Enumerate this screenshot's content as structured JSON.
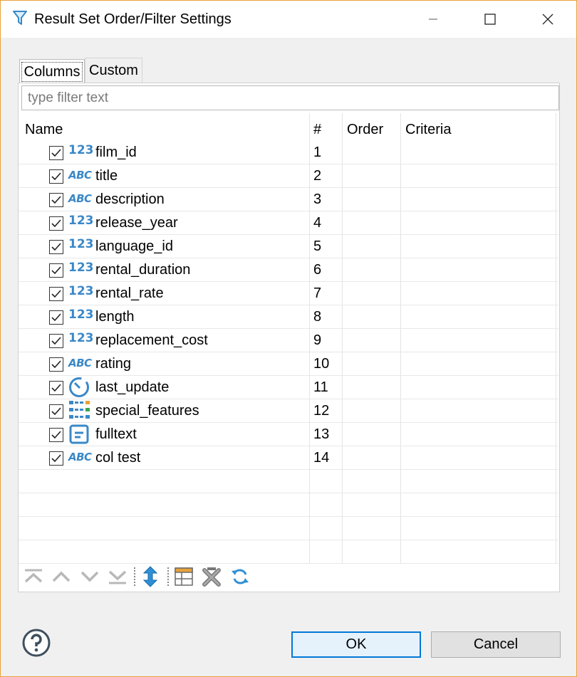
{
  "window": {
    "title": "Result Set Order/Filter Settings"
  },
  "tabs": [
    {
      "label": "Columns",
      "active": true
    },
    {
      "label": "Custom",
      "active": false
    }
  ],
  "filter": {
    "placeholder": "type filter text",
    "value": ""
  },
  "table": {
    "headers": {
      "name": "Name",
      "num": "#",
      "order": "Order",
      "criteria": "Criteria"
    },
    "rows": [
      {
        "checked": true,
        "type_icon": "numeric-123-icon",
        "name": "film_id",
        "num": "1",
        "order": "",
        "criteria": ""
      },
      {
        "checked": true,
        "type_icon": "string-abc-icon",
        "name": "title",
        "num": "2",
        "order": "",
        "criteria": ""
      },
      {
        "checked": true,
        "type_icon": "string-abc-icon",
        "name": "description",
        "num": "3",
        "order": "",
        "criteria": ""
      },
      {
        "checked": true,
        "type_icon": "numeric-123-icon",
        "name": "release_year",
        "num": "4",
        "order": "",
        "criteria": ""
      },
      {
        "checked": true,
        "type_icon": "numeric-123-icon",
        "name": "language_id",
        "num": "5",
        "order": "",
        "criteria": ""
      },
      {
        "checked": true,
        "type_icon": "numeric-123-icon",
        "name": "rental_duration",
        "num": "6",
        "order": "",
        "criteria": ""
      },
      {
        "checked": true,
        "type_icon": "numeric-123-icon",
        "name": "rental_rate",
        "num": "7",
        "order": "",
        "criteria": ""
      },
      {
        "checked": true,
        "type_icon": "numeric-123-icon",
        "name": "length",
        "num": "8",
        "order": "",
        "criteria": ""
      },
      {
        "checked": true,
        "type_icon": "numeric-123-icon",
        "name": "replacement_cost",
        "num": "9",
        "order": "",
        "criteria": ""
      },
      {
        "checked": true,
        "type_icon": "string-abc-icon",
        "name": "rating",
        "num": "10",
        "order": "",
        "criteria": ""
      },
      {
        "checked": true,
        "type_icon": "datetime-clock-icon",
        "name": "last_update",
        "num": "11",
        "order": "",
        "criteria": ""
      },
      {
        "checked": true,
        "type_icon": "array-grid-icon",
        "name": "special_features",
        "num": "12",
        "order": "",
        "criteria": ""
      },
      {
        "checked": true,
        "type_icon": "text-document-icon",
        "name": "fulltext",
        "num": "13",
        "order": "",
        "criteria": ""
      },
      {
        "checked": true,
        "type_icon": "string-abc-icon",
        "name": "col test",
        "num": "14",
        "order": "",
        "criteria": ""
      }
    ]
  },
  "toolbar_icons": [
    "move-top-icon",
    "move-up-icon",
    "move-down-icon",
    "move-bottom-icon",
    "toggle-order-icon",
    "configure-columns-icon",
    "reset-icon",
    "refresh-icon"
  ],
  "buttons": {
    "ok": "OK",
    "cancel": "Cancel"
  },
  "colors": {
    "accent": "#0078d7",
    "type_icon": "#3a88c8",
    "window_border": "#e8a23a"
  }
}
